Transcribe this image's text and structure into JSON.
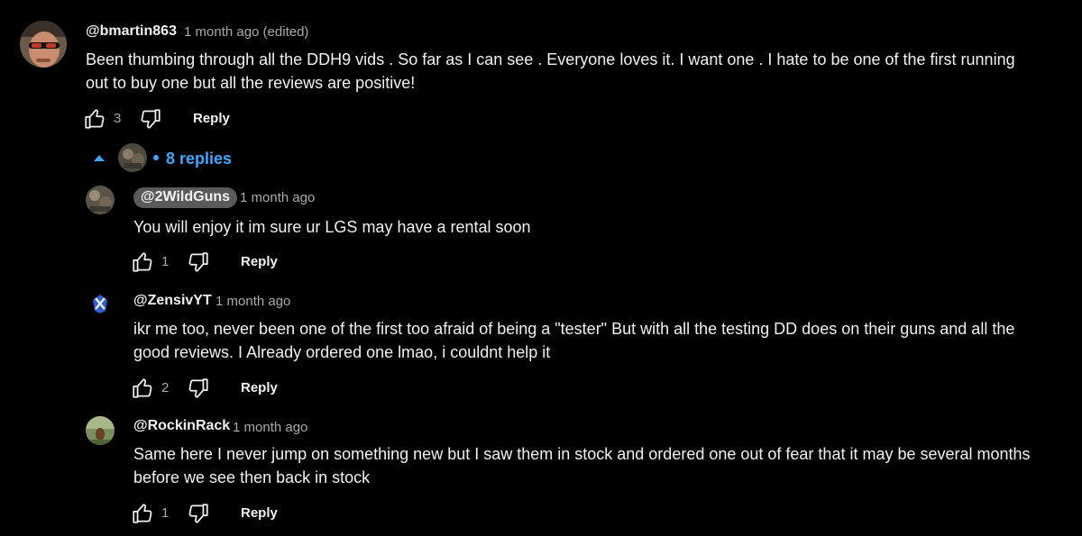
{
  "comment": {
    "author": "@bmartin863",
    "timestamp": "1 month ago (edited)",
    "text": "Been thumbing through all the DDH9 vids . So far as I can see . Everyone loves it. I want one . I hate to be one of the first running out to buy one but all the reviews are positive!",
    "likes": "3",
    "reply_label": "Reply"
  },
  "replies_toggle": {
    "label": "8 replies"
  },
  "replies": [
    {
      "author": "@2WildGuns",
      "timestamp": "1 month ago",
      "text": "You will enjoy it im sure ur LGS may have a rental soon",
      "likes": "1",
      "reply_label": "Reply"
    },
    {
      "author": "@ZensivYT",
      "timestamp": "1 month ago",
      "text": "ikr me too, never been one of the first too afraid of being a \"tester\" But with all the testing DD does on their guns and all the good reviews. I Already ordered one lmao, i couldnt help it",
      "likes": "2",
      "reply_label": "Reply"
    },
    {
      "author": "@RockinRack",
      "timestamp": "1 month ago",
      "text": "Same here I never jump on something new but I saw them in stock and ordered one out of fear that it may be several months before we see then back in stock",
      "likes": "1",
      "reply_label": "Reply"
    }
  ],
  "colors": {
    "background": "#000000",
    "text": "#f1f1f1",
    "muted": "#aaaaaa",
    "link": "#3ea6ff",
    "badge": "#5a5a5a"
  }
}
